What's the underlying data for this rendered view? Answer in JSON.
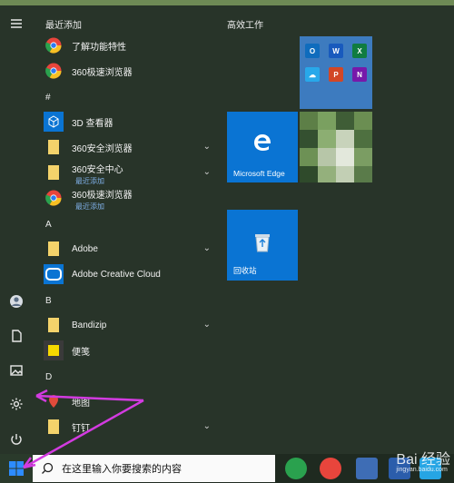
{
  "start_menu": {
    "sections": [
      {
        "label": "最近添加",
        "apps": [
          {
            "name": "了解功能特性",
            "icon": "chrome-like-icon"
          },
          {
            "name": "360极速浏览器",
            "icon": "chrome-like-icon"
          }
        ]
      },
      {
        "label": "#",
        "apps": [
          {
            "name": "3D 查看器",
            "icon": "cube-icon"
          },
          {
            "name": "360安全浏览器",
            "icon": "folder-icon",
            "expandable": true
          },
          {
            "name": "360安全中心",
            "sub": "最近添加",
            "icon": "folder-icon",
            "expandable": true
          },
          {
            "name": "360极速浏览器",
            "sub": "最近添加",
            "icon": "chrome-like-icon"
          }
        ]
      },
      {
        "label": "A",
        "apps": [
          {
            "name": "Adobe",
            "icon": "folder-icon",
            "expandable": true
          },
          {
            "name": "Adobe Creative Cloud",
            "icon": "adobe-cc-icon"
          }
        ]
      },
      {
        "label": "B",
        "apps": [
          {
            "name": "Bandizip",
            "icon": "folder-icon",
            "expandable": true
          },
          {
            "name": "便笺",
            "icon": "sticky-note-icon"
          }
        ]
      },
      {
        "label": "D",
        "apps": [
          {
            "name": "地图",
            "icon": "map-icon"
          },
          {
            "name": "钉钉",
            "icon": "folder-icon",
            "expandable": true
          }
        ]
      }
    ],
    "tiles": {
      "group_title": "高效工作",
      "edge_label": "Microsoft Edge",
      "recycle_label": "回收站"
    }
  },
  "taskbar": {
    "search_placeholder": "在这里输入你要搜索的内容"
  },
  "watermark": {
    "text": "Bai 经验",
    "url": "jingyan.baidu.com"
  },
  "colors": {
    "tile_blue": "#0a74d3",
    "arrow": "#d23be0"
  }
}
